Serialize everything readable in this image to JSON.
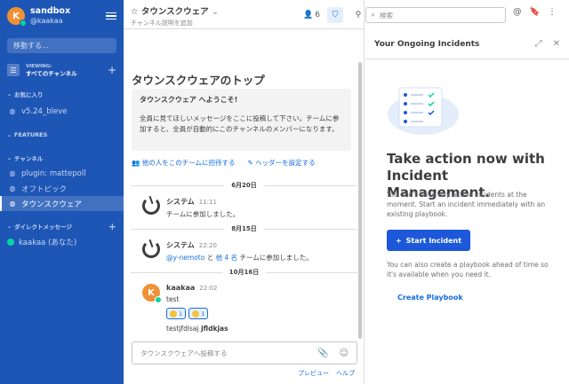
{
  "sidebar": {
    "team_name": "sandbox",
    "team_user": "@kaakaa",
    "avatar_letter": "K",
    "jump_placeholder": "移動する...",
    "viewing_label": "VIEWING:",
    "viewing_value": "すべてのチャンネル",
    "sections": {
      "favorites": "お気に入り",
      "features": "FEATURES",
      "channels": "チャンネル",
      "dms": "ダイレクトメッセージ"
    },
    "favorites": [
      "v5.24_bleve"
    ],
    "channels": [
      "plugin: mattepoll",
      "オフトピック",
      "タウンスクウェア"
    ],
    "dms": [
      "kaakaa (あなた)"
    ]
  },
  "channel": {
    "title": "タウンスクウェア",
    "description": "チャンネル説明を追加",
    "member_count": "6",
    "search_placeholder": "検索",
    "intro_title": "タウンスクウェアのトップ",
    "intro_heading": "タウンスクウェア へようこそ!",
    "intro_text": "全員に見てほしいメッセージをここに投稿して下さい。チームに参加すると、全員が自動的にこのチャンネルのメンバーになります。",
    "invite_link": "他の人をこのチームに招待する",
    "header_link": "ヘッダーを設定する",
    "dates": [
      "6月20日",
      "8月15日",
      "10月16日"
    ],
    "posts": [
      {
        "author": "システム",
        "time": "11:11",
        "message": "チームに参加しました。"
      },
      {
        "author": "システム",
        "time": "22:20",
        "mention": "@y-nemoto",
        "message_mid": " と ",
        "others": "他 4 名",
        "message_end": " チームに参加しました。"
      },
      {
        "author": "kaakaa",
        "time": "22:02",
        "message": "test",
        "reactions": [
          "1",
          "1"
        ],
        "message2_prefix": "testjfdlsaj",
        "message2_bold": "jfldkjas"
      }
    ],
    "input_placeholder": "タウンスクウェアへ投稿する",
    "preview_label": "プレビュー",
    "help_label": "ヘルプ"
  },
  "rhs": {
    "title": "Your Ongoing Incidents",
    "heading": "Take action now with Incident Management.",
    "para1": "You don't have any active incidents at the moment. Start an incident immediately with an existing playbook.",
    "start_button": "Start Incident",
    "para2": "You can also create a playbook ahead of time so it's available when you need it.",
    "create_playbook": "Create Playbook"
  },
  "colors": {
    "sidebar_bg": "#1e56b6",
    "accent": "#166de0",
    "primary_button": "#1c58d9",
    "online": "#06d6a0"
  }
}
